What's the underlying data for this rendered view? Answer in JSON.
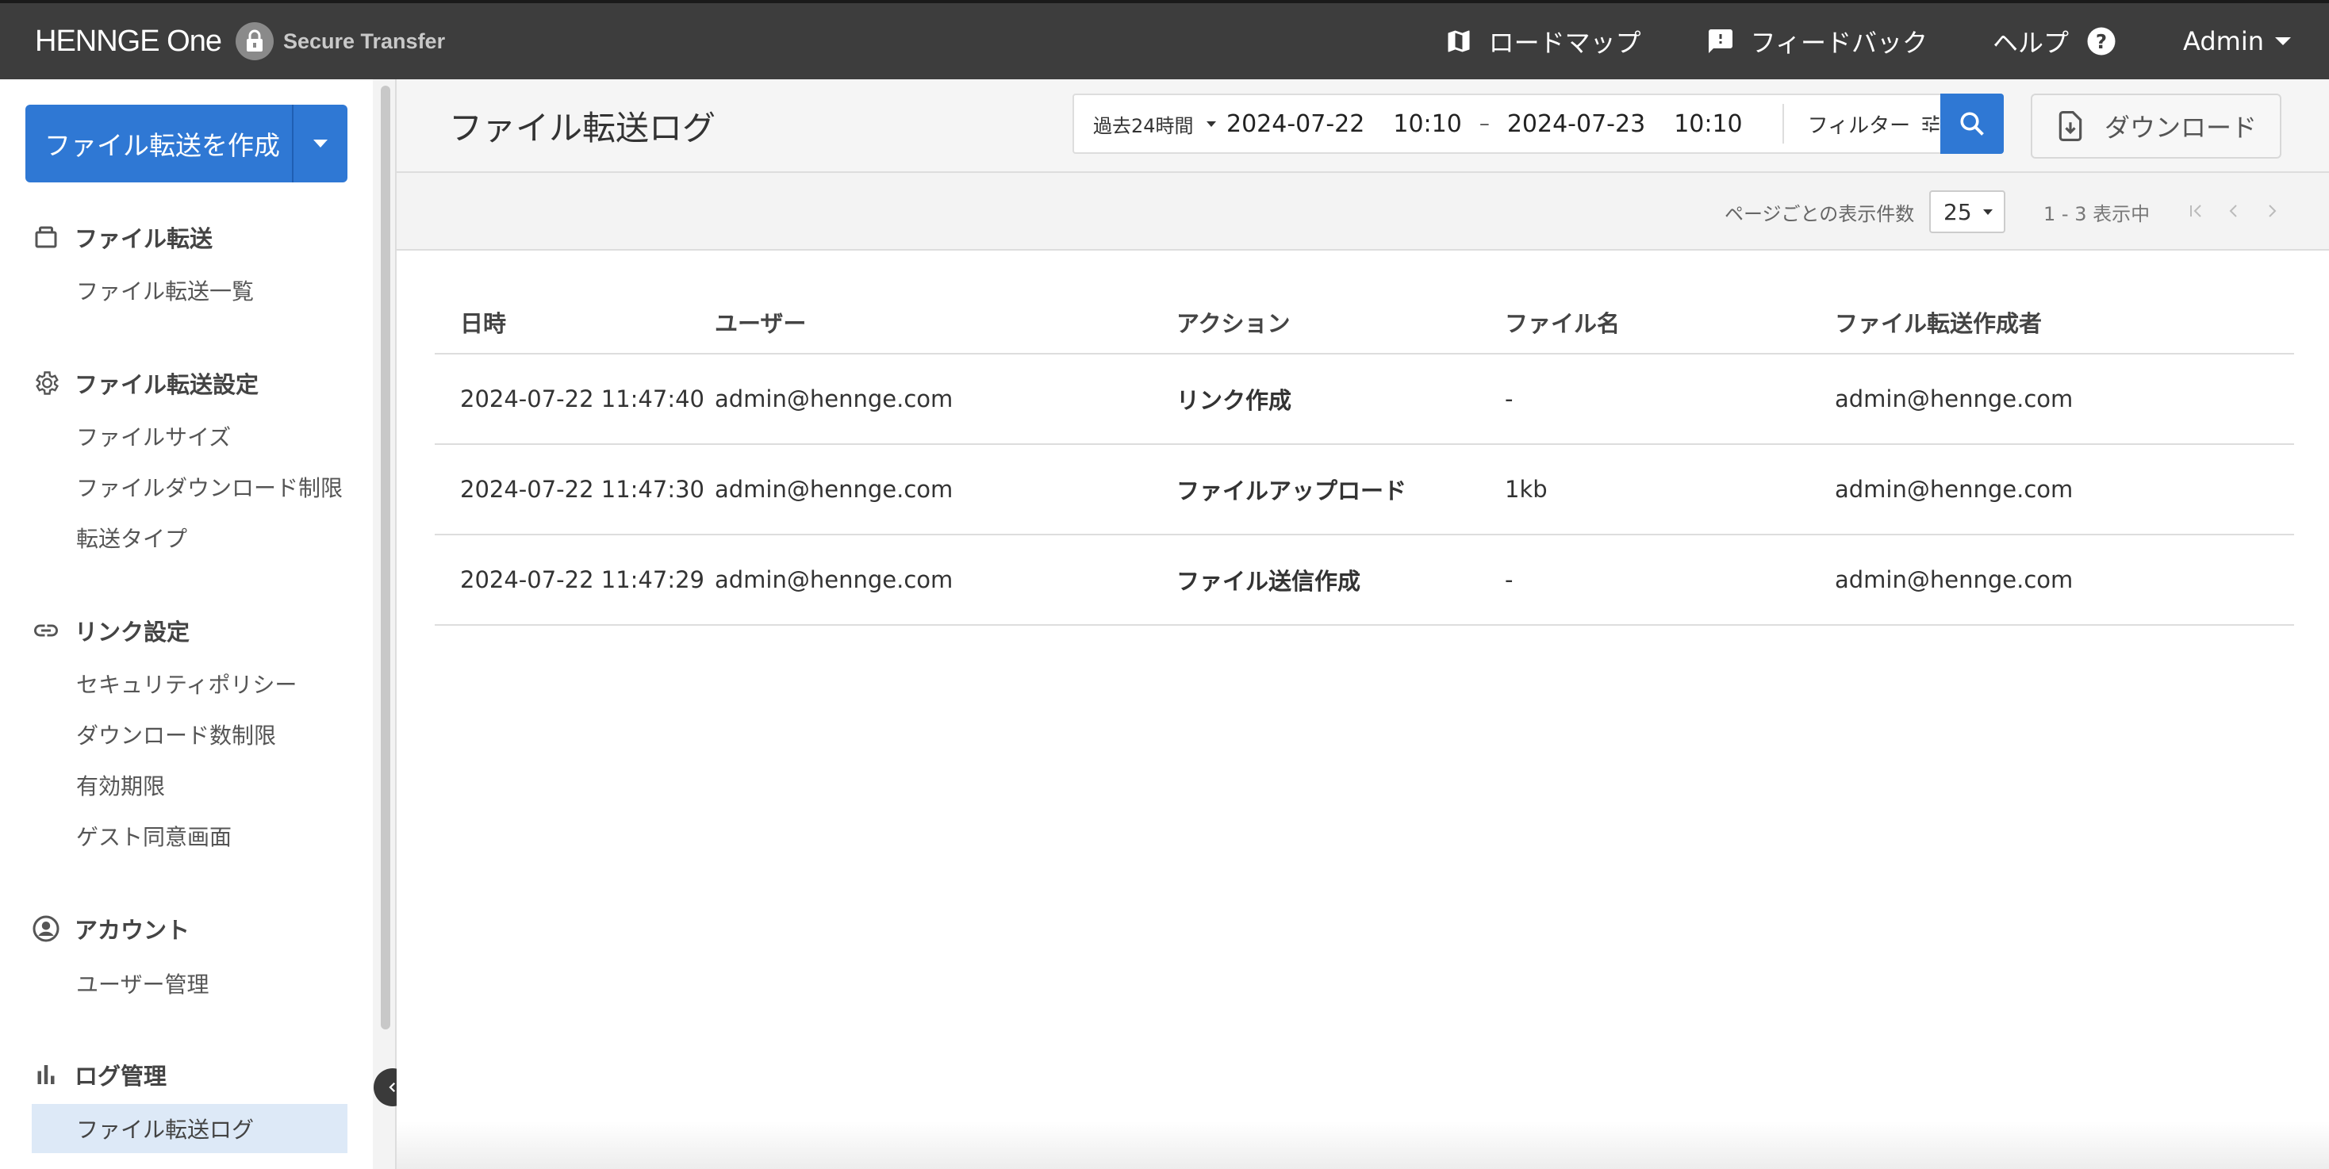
{
  "topbar": {
    "brand": "HENNGE One",
    "product": "Secure Transfer",
    "nav": {
      "roadmap": "ロードマップ",
      "feedback": "フィードバック",
      "help": "ヘルプ",
      "admin": "Admin"
    }
  },
  "sidebar": {
    "create_button": "ファイル転送を作成",
    "sections": [
      {
        "title": "ファイル転送",
        "icon": "briefcase-icon",
        "items": [
          "ファイル転送一覧"
        ]
      },
      {
        "title": "ファイル転送設定",
        "icon": "gear-icon",
        "items": [
          "ファイルサイズ",
          "ファイルダウンロード制限",
          "転送タイプ"
        ]
      },
      {
        "title": "リンク設定",
        "icon": "link-icon",
        "items": [
          "セキュリティポリシー",
          "ダウンロード数制限",
          "有効期限",
          "ゲスト同意画面"
        ]
      },
      {
        "title": "アカウント",
        "icon": "account-circle-icon",
        "items": [
          "ユーザー管理"
        ]
      },
      {
        "title": "ログ管理",
        "icon": "bar-chart-icon",
        "items": [
          "ファイル転送ログ"
        ]
      }
    ],
    "active_item": "ファイル転送ログ"
  },
  "header": {
    "title": "ファイル転送ログ",
    "range_select": "過去24時間",
    "from_date": "2024-07-22",
    "from_time": "10:10",
    "dash": "–",
    "to_date": "2024-07-23",
    "to_time": "10:10",
    "filter_label": "フィルター",
    "download_label": "ダウンロード"
  },
  "pager": {
    "per_page_label": "ページごとの表示件数",
    "per_page_value": "25",
    "range_text": "1 - 3 表示中"
  },
  "table": {
    "headers": [
      "日時",
      "ユーザー",
      "アクション",
      "ファイル名",
      "ファイル転送作成者"
    ],
    "rows": [
      [
        "2024-07-22 11:47:40",
        "admin@hennge.com",
        "リンク作成",
        "-",
        "admin@hennge.com"
      ],
      [
        "2024-07-22 11:47:30",
        "admin@hennge.com",
        "ファイルアップロード",
        "1kb",
        "admin@hennge.com"
      ],
      [
        "2024-07-22 11:47:29",
        "admin@hennge.com",
        "ファイル送信作成",
        "-",
        "admin@hennge.com"
      ]
    ]
  },
  "colors": {
    "accent": "#2f78d4",
    "topbar": "#3d3d3d",
    "active_nav_bg": "#dde9f7"
  }
}
